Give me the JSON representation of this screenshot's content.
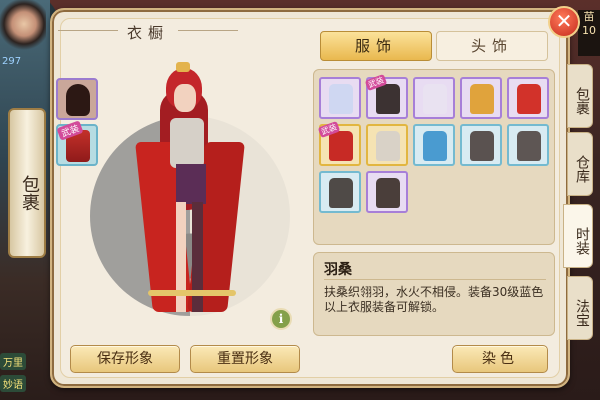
{
  "window": {
    "title": "衣橱"
  },
  "hud": {
    "level_number": "297",
    "left_labels": [
      "万里",
      "妙语"
    ],
    "right_top": "苗",
    "right_number": "10"
  },
  "scroll_tab": {
    "label": "包裹"
  },
  "tabs": [
    {
      "label": "服饰",
      "active": true
    },
    {
      "label": "头饰",
      "active": false
    }
  ],
  "side_tabs": [
    {
      "label": "包裹",
      "active": false
    },
    {
      "label": "仓库",
      "active": false
    },
    {
      "label": "时装",
      "active": true
    },
    {
      "label": "法宝",
      "active": false
    }
  ],
  "equipped_badge": "武装",
  "grid_items": [
    {
      "name": "outfit-1",
      "frame": "purple",
      "color": "#cfd7f2"
    },
    {
      "name": "outfit-2",
      "frame": "purple",
      "color": "#3c3232",
      "badge": "武装"
    },
    {
      "name": "outfit-3",
      "frame": "purple",
      "color": "#e9e2f1"
    },
    {
      "name": "outfit-4",
      "frame": "purple",
      "color": "#e0a33c"
    },
    {
      "name": "outfit-5",
      "frame": "purple",
      "color": "#d2322a"
    },
    {
      "name": "outfit-6",
      "frame": "gold",
      "color": "#c72a25",
      "badge": "武装"
    },
    {
      "name": "outfit-7",
      "frame": "gold",
      "color": "#d9d2c7"
    },
    {
      "name": "outfit-8",
      "frame": "blue",
      "color": "#4a9bd0"
    },
    {
      "name": "outfit-9",
      "frame": "blue",
      "color": "#5a5250"
    },
    {
      "name": "outfit-10",
      "frame": "blue",
      "color": "#5e5654"
    },
    {
      "name": "outfit-11",
      "frame": "blue",
      "color": "#4f4a47"
    },
    {
      "name": "outfit-12",
      "frame": "purple",
      "color": "#4a3e3a"
    }
  ],
  "item": {
    "name": "羽桑",
    "description": "扶桑织翎羽，水火不相侵。装备30级蓝色以上衣服装备可解锁。"
  },
  "buttons": {
    "save": "保存形象",
    "reset": "重置形象",
    "dye": "染色"
  },
  "info_glyph": "i",
  "close_glyph": "✕"
}
